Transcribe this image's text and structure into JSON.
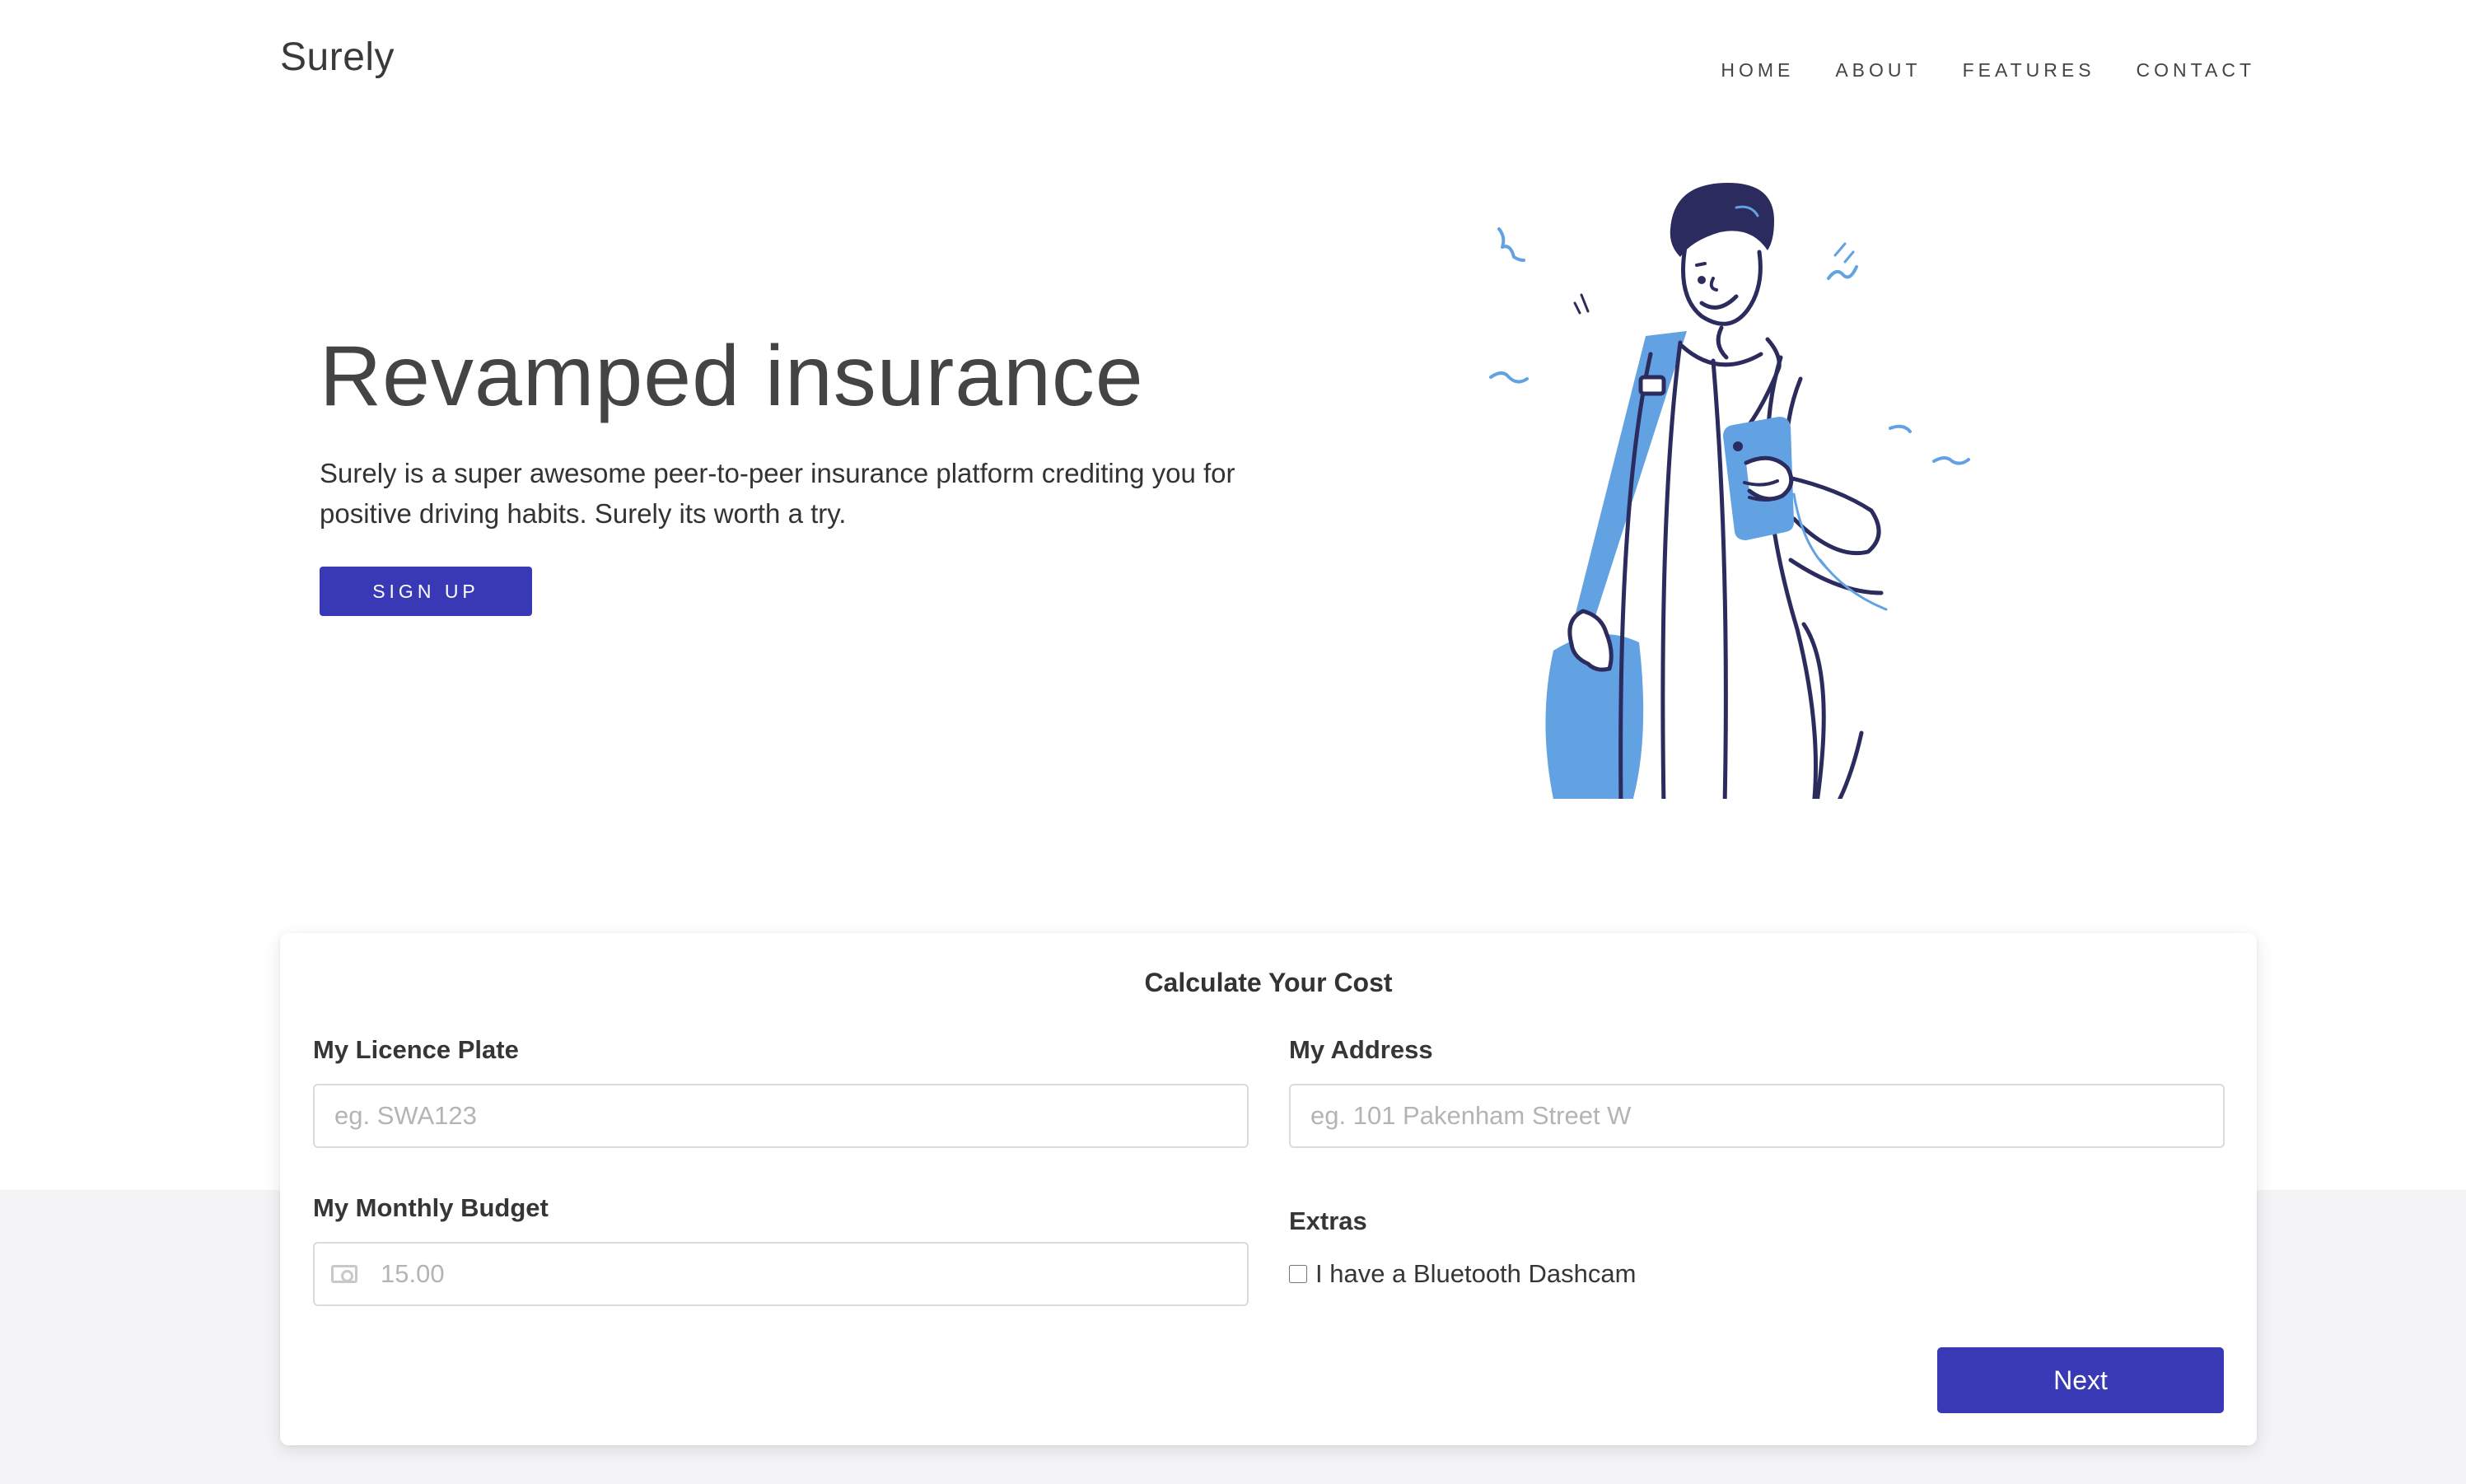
{
  "brand": "Surely",
  "nav": {
    "items": [
      "HOME",
      "ABOUT",
      "FEATURES",
      "CONTACT"
    ]
  },
  "hero": {
    "title": "Revamped insurance",
    "text": "Surely is a super awesome peer-to-peer insurance platform crediting you for positive driving habits. Surely its worth a try.",
    "signup_label": "SIGN UP"
  },
  "form": {
    "title": "Calculate Your Cost",
    "plate": {
      "label": "My Licence Plate",
      "placeholder": "eg. SWA123"
    },
    "address": {
      "label": "My Address",
      "placeholder": "eg. 101 Pakenham Street W"
    },
    "budget": {
      "label": "My Monthly Budget",
      "placeholder": "15.00",
      "icon": "money-icon"
    },
    "extras": {
      "label": "Extras",
      "checkbox_label": "I have a Bluetooth Dashcam",
      "checked": false
    },
    "next_label": "Next"
  },
  "colors": {
    "accent": "#3939b6",
    "illustration_dark": "#2b2b5e",
    "illustration_blue": "#62a2e3"
  }
}
